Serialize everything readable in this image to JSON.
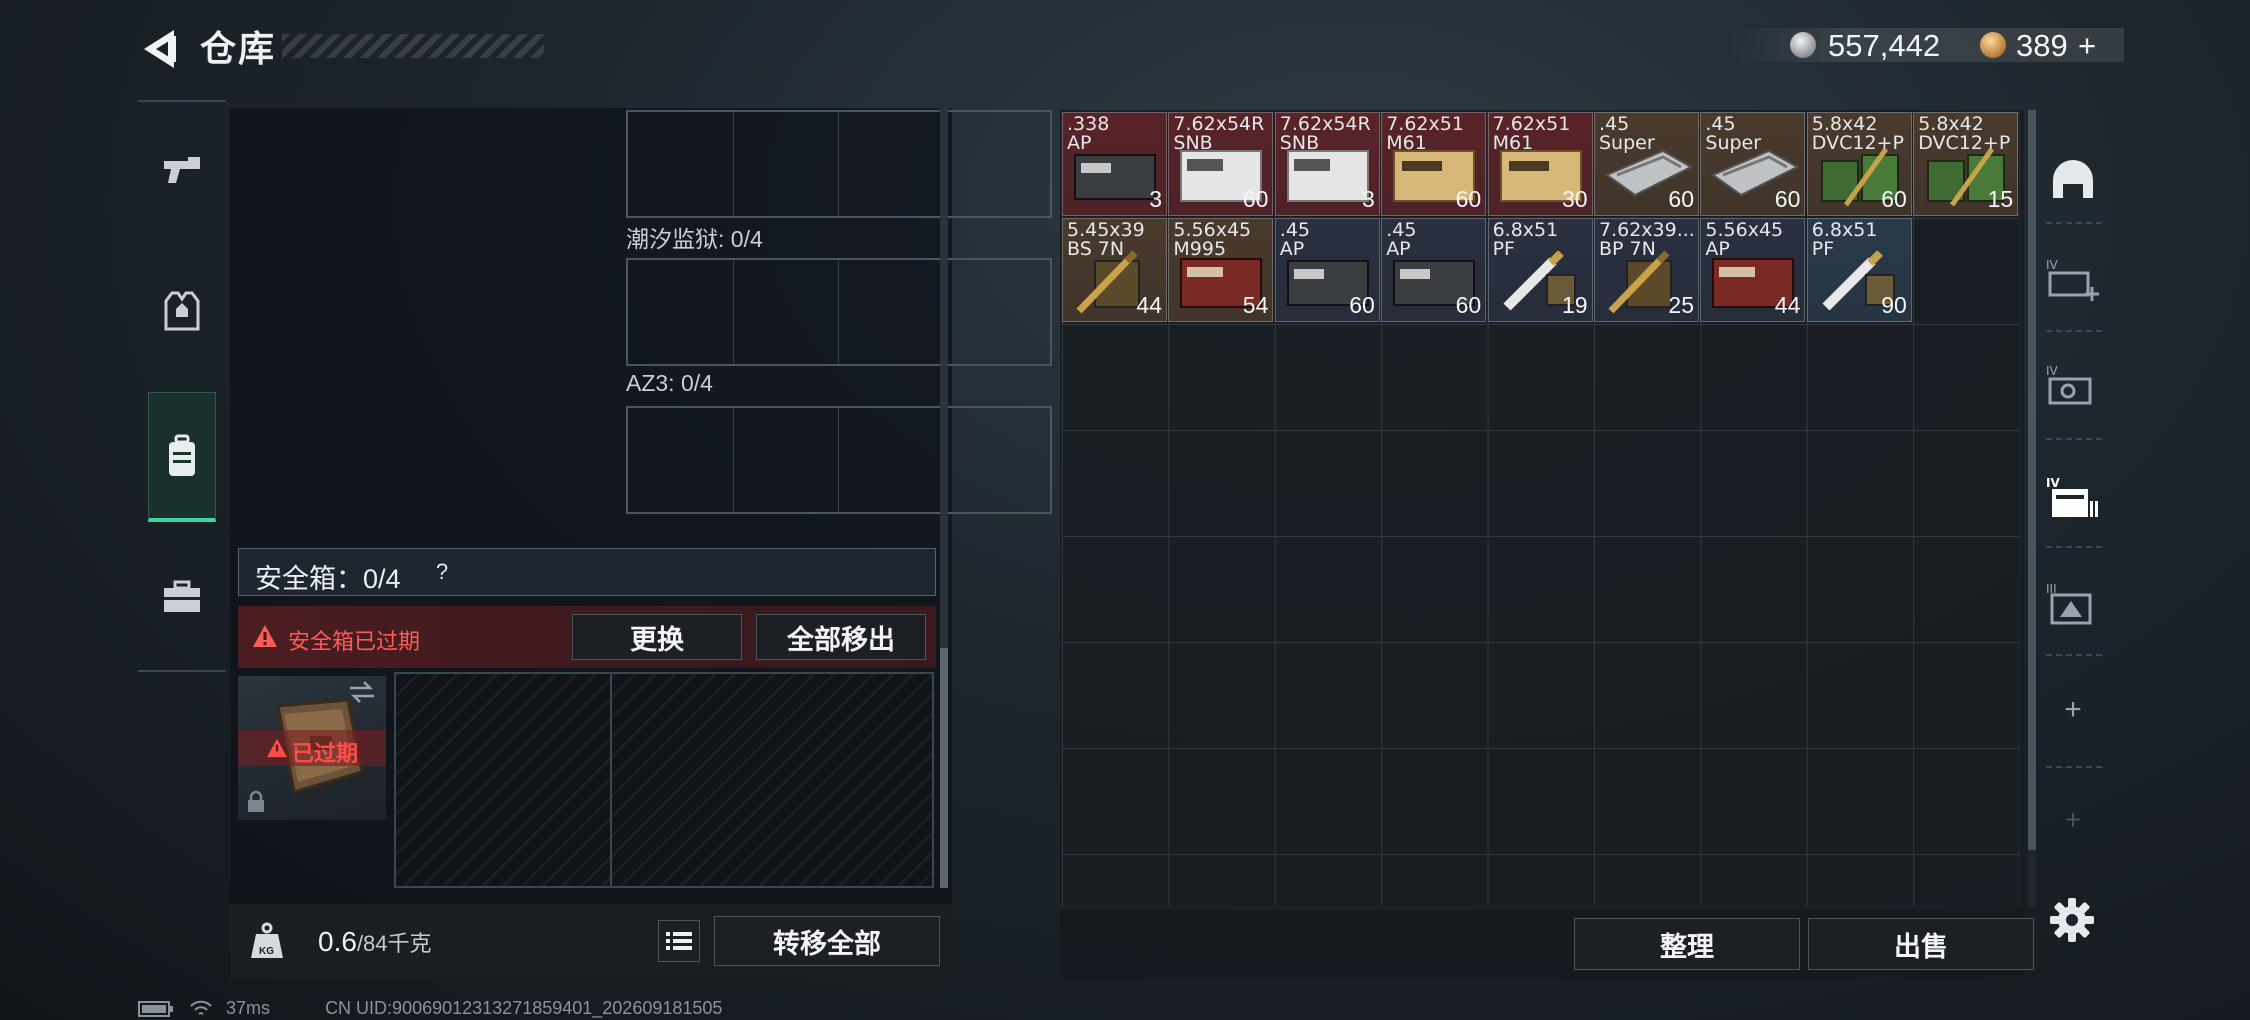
{
  "header": {
    "title": "仓库"
  },
  "currency": {
    "silver": "557,442",
    "gold": "389",
    "gold_add": "+"
  },
  "slots": [
    {
      "label": "潮汐监狱: 0/4"
    },
    {
      "label": "AZ3: 0/4"
    }
  ],
  "safe_box": {
    "title": "安全箱：0/4",
    "help": "?",
    "expired_warning": "安全箱已过期",
    "replace_button": "更换",
    "move_all_out_button": "全部移出",
    "expired_badge": "已过期"
  },
  "backpack": {
    "weight_current": "0.6",
    "weight_max": "/84千克",
    "kg_label": "KG",
    "transfer_all_button": "转移全部"
  },
  "storage": {
    "items": [
      {
        "name": ".338\nAP",
        "qty": "3",
        "bg": "#5a2328",
        "type": "box-dark"
      },
      {
        "name": "7.62x54R\nSNB",
        "qty": "60",
        "bg": "#5a2328",
        "type": "box-white"
      },
      {
        "name": "7.62x54R\nSNB",
        "qty": "3",
        "bg": "#5a2328",
        "type": "box-white"
      },
      {
        "name": "7.62x51\nM61",
        "qty": "60",
        "bg": "#5a2328",
        "type": "box-tan"
      },
      {
        "name": "7.62x51\nM61",
        "qty": "30",
        "bg": "#5a2328",
        "type": "box-tan"
      },
      {
        "name": ".45\nSuper",
        "qty": "60",
        "bg": "#4a3a2c",
        "type": "box-silver"
      },
      {
        "name": ".45\nSuper",
        "qty": "60",
        "bg": "#4a3a2c",
        "type": "box-silver"
      },
      {
        "name": "5.8x42\nDVC12+P",
        "qty": "60",
        "bg": "#4a3a2c",
        "type": "box-green"
      },
      {
        "name": "5.8x42\nDVC12+P",
        "qty": "15",
        "bg": "#4a3a2c",
        "type": "box-green"
      },
      {
        "name": "5.45x39\nBS 7N",
        "qty": "44",
        "bg": "#4a3a2c",
        "type": "box-ammo"
      },
      {
        "name": "5.56x45\nM995",
        "qty": "54",
        "bg": "#4a3a2c",
        "type": "box-red"
      },
      {
        "name": ".45\nAP",
        "qty": "60",
        "bg": "#2a3040",
        "type": "box-dark"
      },
      {
        "name": ".45\nAP",
        "qty": "60",
        "bg": "#2a3040",
        "type": "box-dark"
      },
      {
        "name": "6.8x51\nPF",
        "qty": "19",
        "bg": "#2a3040",
        "type": "bullet"
      },
      {
        "name": "7.62x39...\nBP 7N",
        "qty": "25",
        "bg": "#2a3040",
        "type": "box-ammo"
      },
      {
        "name": "5.56x45\nAP",
        "qty": "44",
        "bg": "#2a3040",
        "type": "box-red"
      },
      {
        "name": "6.8x51\nPF",
        "qty": "90",
        "bg": "#2a3a4a",
        "type": "bullet"
      }
    ],
    "sort_button": "整理",
    "sell_button": "出售"
  },
  "filters": {
    "add_label": "+",
    "tier_labels": [
      "IV",
      "IV",
      "IV",
      "III"
    ]
  },
  "status": {
    "ping": "37ms",
    "uid": "CN UID:9006901231327185940​1_202609181505"
  }
}
